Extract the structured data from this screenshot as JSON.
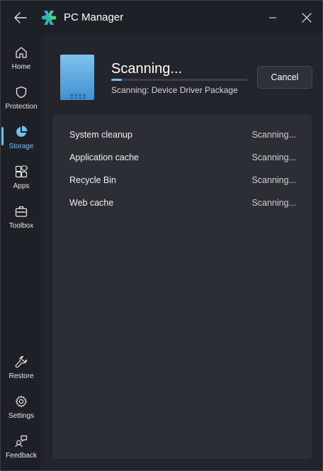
{
  "app": {
    "title": "PC Manager"
  },
  "sidebar": {
    "items": [
      {
        "label": "Home",
        "icon": "home-icon"
      },
      {
        "label": "Protection",
        "icon": "shield-icon"
      },
      {
        "label": "Storage",
        "icon": "pie-chart-icon",
        "active": true
      },
      {
        "label": "Apps",
        "icon": "apps-icon"
      },
      {
        "label": "Toolbox",
        "icon": "toolbox-icon"
      }
    ],
    "bottom_items": [
      {
        "label": "Restore",
        "icon": "wrench-icon"
      },
      {
        "label": "Settings",
        "icon": "gear-icon"
      },
      {
        "label": "Feedback",
        "icon": "feedback-icon"
      }
    ]
  },
  "scan": {
    "title": "Scanning...",
    "subtitle": "Scanning: Device Driver Package",
    "progress": 0.08,
    "cancel_label": "Cancel"
  },
  "rows": [
    {
      "name": "System cleanup",
      "status": "Scanning..."
    },
    {
      "name": "Application cache",
      "status": "Scanning..."
    },
    {
      "name": "Recycle Bin",
      "status": "Scanning..."
    },
    {
      "name": "Web cache",
      "status": "Scanning..."
    }
  ],
  "colors": {
    "accent": "#6cc1f5",
    "background": "#1d2026",
    "panel": "#2b2f35"
  }
}
